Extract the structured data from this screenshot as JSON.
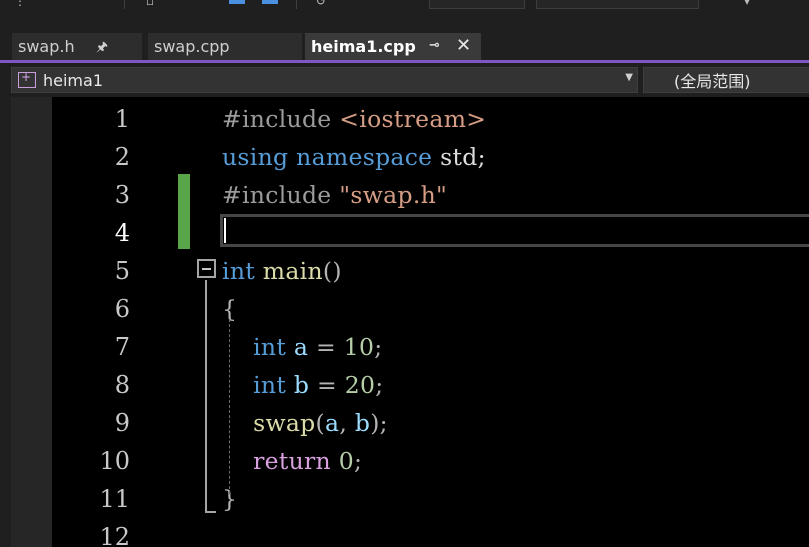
{
  "tabs": [
    {
      "label": "swap.h",
      "pinned": true,
      "active": false
    },
    {
      "label": "swap.cpp",
      "pinned": false,
      "active": false
    },
    {
      "label": "heima1.cpp",
      "pinned": true,
      "active": true
    }
  ],
  "nav": {
    "project": "heima1",
    "scope": "(全局范围)"
  },
  "editor": {
    "current_line": 4,
    "lines": [
      {
        "n": "1",
        "tokens": [
          {
            "t": "#include ",
            "c": "pre"
          },
          {
            "t": "<iostream>",
            "c": "str"
          }
        ]
      },
      {
        "n": "2",
        "tokens": [
          {
            "t": "using ",
            "c": "kw-blue"
          },
          {
            "t": "namespace ",
            "c": "kw-blue"
          },
          {
            "t": "std;",
            "c": "plain"
          }
        ]
      },
      {
        "n": "3",
        "tokens": [
          {
            "t": "#include ",
            "c": "pre"
          },
          {
            "t": "\"swap.h\"",
            "c": "str"
          }
        ]
      },
      {
        "n": "4",
        "tokens": []
      },
      {
        "n": "5",
        "tokens": [
          {
            "t": "int ",
            "c": "kw-blue"
          },
          {
            "t": "main",
            "c": "func"
          },
          {
            "t": "()",
            "c": "punc"
          }
        ]
      },
      {
        "n": "6",
        "tokens": [
          {
            "t": "{",
            "c": "punc"
          }
        ]
      },
      {
        "n": "7",
        "tokens": [
          {
            "t": "    ",
            "c": "plain"
          },
          {
            "t": "int ",
            "c": "kw-blue"
          },
          {
            "t": "a",
            "c": "var"
          },
          {
            "t": " = ",
            "c": "punc"
          },
          {
            "t": "10",
            "c": "num"
          },
          {
            "t": ";",
            "c": "punc"
          }
        ]
      },
      {
        "n": "8",
        "tokens": [
          {
            "t": "    ",
            "c": "plain"
          },
          {
            "t": "int ",
            "c": "kw-blue"
          },
          {
            "t": "b",
            "c": "var"
          },
          {
            "t": " = ",
            "c": "punc"
          },
          {
            "t": "20",
            "c": "num"
          },
          {
            "t": ";",
            "c": "punc"
          }
        ]
      },
      {
        "n": "9",
        "tokens": [
          {
            "t": "    ",
            "c": "plain"
          },
          {
            "t": "swap",
            "c": "func"
          },
          {
            "t": "(",
            "c": "punc"
          },
          {
            "t": "a",
            "c": "var"
          },
          {
            "t": ", ",
            "c": "punc"
          },
          {
            "t": "b",
            "c": "var"
          },
          {
            "t": ");",
            "c": "punc"
          }
        ]
      },
      {
        "n": "10",
        "tokens": [
          {
            "t": "    ",
            "c": "plain"
          },
          {
            "t": "return ",
            "c": "kw-purple"
          },
          {
            "t": "0",
            "c": "num"
          },
          {
            "t": ";",
            "c": "punc"
          }
        ]
      },
      {
        "n": "11",
        "tokens": [
          {
            "t": "}",
            "c": "punc"
          }
        ]
      },
      {
        "n": "12",
        "tokens": []
      }
    ]
  }
}
